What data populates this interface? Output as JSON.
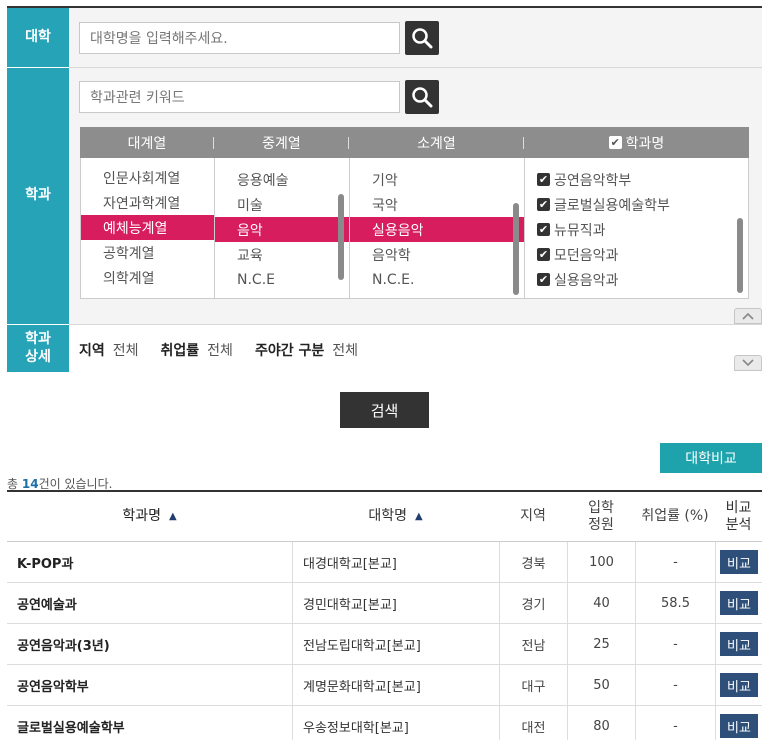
{
  "filter": {
    "university": {
      "label": "대학",
      "placeholder": "대학명을 입력해주세요."
    },
    "department": {
      "label": "학과",
      "keyword_placeholder": "학과관련 키워드",
      "columns": {
        "major": {
          "header": "대계열",
          "items": [
            "인문사회계열",
            "자연과학계열",
            "예체능계열",
            "공학계열",
            "의학계열"
          ],
          "selected_index": 2
        },
        "middle": {
          "header": "중계열",
          "items": [
            "응용예술",
            "미술",
            "음악",
            "교육",
            "N.C.E"
          ],
          "selected_index": 2
        },
        "minor": {
          "header": "소계열",
          "items": [
            "기악",
            "국악",
            "실용음악",
            "음악학",
            "N.C.E."
          ],
          "selected_index": 2
        },
        "dept": {
          "header": "학과명",
          "items": [
            "공연음악학부",
            "글로벌실용예술학부",
            "뉴뮤직과",
            "모던음악과",
            "실용음악과"
          ]
        }
      }
    },
    "detail": {
      "label_line1": "학과",
      "label_line2": "상세",
      "region_label": "지역",
      "region_value": "전체",
      "employment_label": "취업률",
      "employment_value": "전체",
      "daynight_label": "주야간 구분",
      "daynight_value": "전체"
    }
  },
  "search_button": "검색",
  "compare_button": "대학비교",
  "total": {
    "prefix": "총 ",
    "count": "14",
    "suffix": "건이 있습니다."
  },
  "table": {
    "headers": {
      "dept": "학과명",
      "univ": "대학명",
      "region": "지역",
      "quota_line1": "입학",
      "quota_line2": "정원",
      "employment": "취업률 (%)",
      "compare_line1": "비교",
      "compare_line2": "분석"
    },
    "compare_label": "비교",
    "rows": [
      {
        "dept": "K-POP과",
        "univ": "대경대학교[본교]",
        "region": "경북",
        "quota": "100",
        "employment": "-"
      },
      {
        "dept": "공연예술과",
        "univ": "경민대학교[본교]",
        "region": "경기",
        "quota": "40",
        "employment": "58.5"
      },
      {
        "dept": "공연음악과(3년)",
        "univ": "전남도립대학교[본교]",
        "region": "전남",
        "quota": "25",
        "employment": "-"
      },
      {
        "dept": "공연음악학부",
        "univ": "계명문화대학교[본교]",
        "region": "대구",
        "quota": "50",
        "employment": "-"
      },
      {
        "dept": "글로벌실용예술학부",
        "univ": "우송정보대학[본교]",
        "region": "대전",
        "quota": "80",
        "employment": "-"
      }
    ]
  },
  "colors": {
    "teal": "#27a3b8",
    "selected": "#d71d5e",
    "dark": "#333333",
    "compare": "#2d4f7a"
  }
}
